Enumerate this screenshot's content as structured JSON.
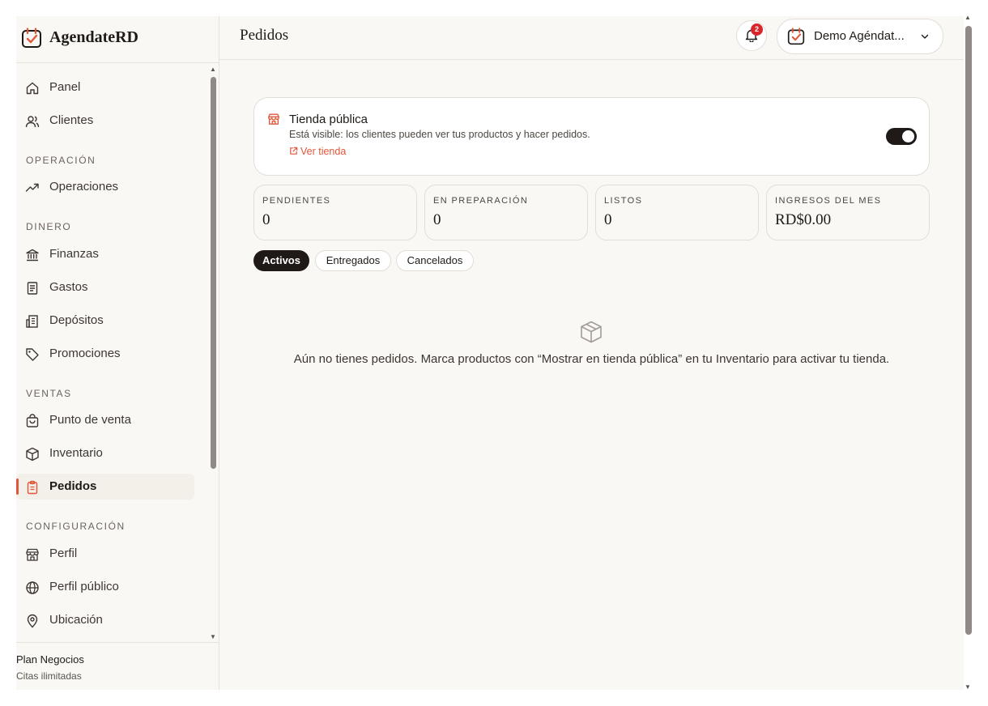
{
  "brand": {
    "name": "AgendateRD"
  },
  "nav": {
    "items": [
      {
        "label": "Panel",
        "icon": "home-icon"
      },
      {
        "label": "Clientes",
        "icon": "users-icon"
      },
      {
        "label": "Operaciones",
        "icon": "trend-icon"
      },
      {
        "label": "Finanzas",
        "icon": "bank-icon"
      },
      {
        "label": "Gastos",
        "icon": "receipt-icon"
      },
      {
        "label": "Depósitos",
        "icon": "building-icon"
      },
      {
        "label": "Promociones",
        "icon": "tag-icon"
      },
      {
        "label": "Punto de venta",
        "icon": "bag-icon"
      },
      {
        "label": "Inventario",
        "icon": "box-icon"
      },
      {
        "label": "Pedidos",
        "icon": "clipboard-icon"
      },
      {
        "label": "Perfil",
        "icon": "store-icon"
      },
      {
        "label": "Perfil público",
        "icon": "globe-icon"
      },
      {
        "label": "Ubicación",
        "icon": "pin-icon"
      }
    ],
    "sections": [
      "OPERACIÓN",
      "DINERO",
      "VENTAS",
      "CONFIGURACIÓN"
    ],
    "active": "Pedidos"
  },
  "plan": {
    "name": "Plan Negocios",
    "sub": "Citas ilimitadas"
  },
  "header": {
    "title": "Pedidos",
    "notifications": "2",
    "account": "Demo Agéndat..."
  },
  "store": {
    "title": "Tienda pública",
    "description": "Está visible: los clientes pueden ver tus productos y hacer pedidos.",
    "link": "Ver tienda",
    "enabled": true
  },
  "stats": [
    {
      "label": "PENDIENTES",
      "value": "0"
    },
    {
      "label": "EN PREPARACIÓN",
      "value": "0"
    },
    {
      "label": "LISTOS",
      "value": "0"
    },
    {
      "label": "INGRESOS DEL MES",
      "value": "RD$0.00"
    }
  ],
  "tabs": [
    {
      "label": "Activos",
      "active": true
    },
    {
      "label": "Entregados",
      "active": false
    },
    {
      "label": "Cancelados",
      "active": false
    }
  ],
  "empty": {
    "message": "Aún no tienes pedidos. Marca productos con “Mostrar en tienda pública” en tu Inventario para activar tu tienda."
  },
  "colors": {
    "accent": "#e0573a",
    "dark": "#1f1a17",
    "background": "#faf8f5",
    "badge": "#d8262d"
  }
}
